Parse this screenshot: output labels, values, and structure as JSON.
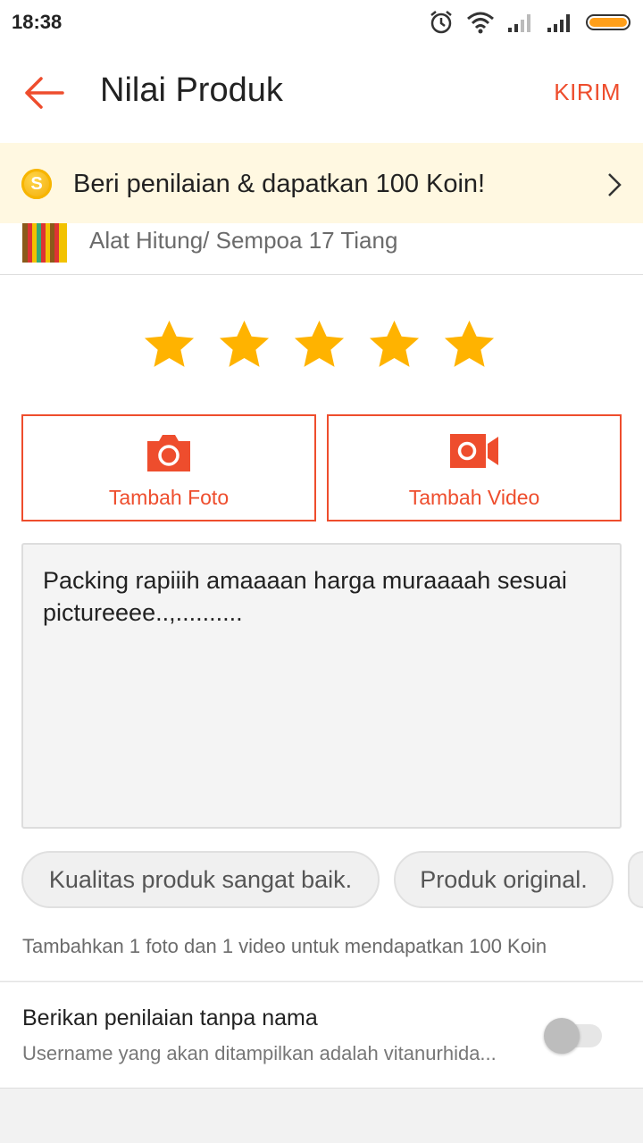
{
  "status_bar": {
    "time": "18:38"
  },
  "header": {
    "title": "Nilai Produk",
    "action": "KIRIM",
    "back_icon": "arrow-left-icon"
  },
  "banner": {
    "coin_symbol": "S",
    "text": "Beri penilaian & dapatkan 100 Koin!"
  },
  "product": {
    "name": "Alat Hitung/ Sempoa 17 Tiang"
  },
  "rating": {
    "value": 5,
    "max": 5,
    "star_color": "#ffb300"
  },
  "media": {
    "photo_label": "Tambah Foto",
    "video_label": "Tambah Video"
  },
  "review": {
    "text": "Packing rapiiih amaaaan harga muraaaah sesuai pictureeee..,.........."
  },
  "chips": [
    "Kualitas produk sangat baik.",
    "Produk original.",
    ""
  ],
  "hint": "Tambahkan 1 foto dan 1 video untuk mendapatkan 100 Koin",
  "anonymous": {
    "title": "Berikan penilaian tanpa nama",
    "subtitle": "Username yang akan ditampilkan adalah vitanurhida...",
    "enabled": false
  },
  "colors": {
    "accent": "#ee4d2d",
    "banner_bg": "#fff8e1"
  }
}
